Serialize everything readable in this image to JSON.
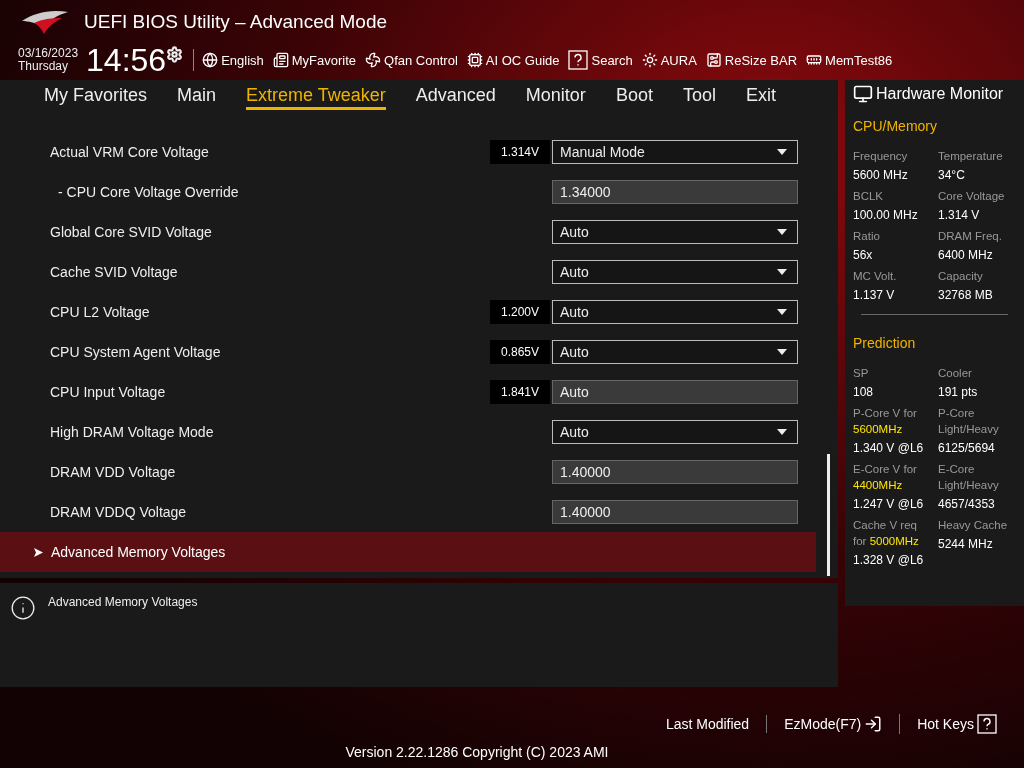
{
  "window": {
    "title": "UEFI BIOS Utility – Advanced Mode"
  },
  "clock": {
    "date": "03/16/2023",
    "day": "Thursday",
    "time": "14:56"
  },
  "toolbar": [
    {
      "label": "English",
      "kind": "globe"
    },
    {
      "label": "MyFavorite",
      "kind": "list"
    },
    {
      "label": "Qfan Control",
      "kind": "fan"
    },
    {
      "label": "AI OC Guide",
      "kind": "chip"
    },
    {
      "label": "Search",
      "kind": "help"
    },
    {
      "label": "AURA",
      "kind": "light"
    },
    {
      "label": "ReSize BAR",
      "kind": "card"
    },
    {
      "label": "MemTest86",
      "kind": "memory"
    }
  ],
  "tabs": [
    {
      "label": "My Favorites",
      "selected": false
    },
    {
      "label": "Main",
      "selected": false
    },
    {
      "label": "Extreme Tweaker",
      "selected": true
    },
    {
      "label": "Advanced",
      "selected": false
    },
    {
      "label": "Monitor",
      "selected": false
    },
    {
      "label": "Boot",
      "selected": false
    },
    {
      "label": "Tool",
      "selected": false
    },
    {
      "label": "Exit",
      "selected": false
    }
  ],
  "settings": [
    {
      "label": "Actual VRM Core Voltage",
      "reading": "1.314V",
      "kind": "dropdown",
      "value": "Manual Mode"
    },
    {
      "label": "- CPU Core Voltage Override",
      "kind": "input",
      "value": "1.34000",
      "indented": true
    },
    {
      "label": "Global Core SVID Voltage",
      "kind": "dropdown",
      "value": "Auto"
    },
    {
      "label": "Cache SVID Voltage",
      "kind": "dropdown",
      "value": "Auto"
    },
    {
      "label": "CPU L2 Voltage",
      "reading": "1.200V",
      "kind": "dropdown",
      "value": "Auto"
    },
    {
      "label": "CPU System Agent Voltage",
      "reading": "0.865V",
      "kind": "dropdown",
      "value": "Auto"
    },
    {
      "label": "CPU Input Voltage",
      "reading": "1.841V",
      "kind": "input",
      "value": "Auto"
    },
    {
      "label": "High DRAM Voltage Mode",
      "kind": "dropdown",
      "value": "Auto"
    },
    {
      "label": "DRAM VDD Voltage",
      "kind": "input",
      "value": "1.40000"
    },
    {
      "label": "DRAM VDDQ Voltage",
      "kind": "input",
      "value": "1.40000"
    },
    {
      "label": "Advanced Memory Voltages",
      "kind": "submenu",
      "selected": true
    }
  ],
  "help": {
    "text": "Advanced Memory Voltages"
  },
  "hardware_monitor": {
    "title": "Hardware Monitor",
    "sections": [
      {
        "title": "CPU/Memory",
        "items": [
          {
            "label": "Frequency",
            "value": "5600 MHz"
          },
          {
            "label": "Temperature",
            "value": "34°C"
          },
          {
            "label": "BCLK",
            "value": "100.00 MHz"
          },
          {
            "label": "Core Voltage",
            "value": "1.314 V"
          },
          {
            "label": "Ratio",
            "value": "56x"
          },
          {
            "label": "DRAM Freq.",
            "value": "6400 MHz"
          },
          {
            "label": "MC Volt.",
            "value": "1.137 V"
          },
          {
            "label": "Capacity",
            "value": "32768 MB"
          }
        ]
      },
      {
        "title": "Prediction",
        "items": [
          {
            "label": "SP",
            "value": "108"
          },
          {
            "label": "Cooler",
            "value": "191 pts"
          },
          {
            "label": "P-Core V for **5600MHz**",
            "value": "1.340 V @L6"
          },
          {
            "label": "P-Core Light/Heavy",
            "value": "6125/5694"
          },
          {
            "label": "E-Core V for **4400MHz**",
            "value": "1.247 V @L6"
          },
          {
            "label": "E-Core Light/Heavy",
            "value": "4657/4353"
          },
          {
            "label": "Cache V req for **5000MHz**",
            "value": "1.328 V @L6"
          },
          {
            "label": "Heavy Cache",
            "value": "5244 MHz"
          }
        ]
      }
    ]
  },
  "footer": {
    "actions": [
      {
        "label": "Last Modified",
        "kind": "text"
      },
      {
        "label": "EzMode(F7)",
        "kind": "exit"
      },
      {
        "label": "Hot Keys",
        "kind": "help"
      }
    ],
    "version": "Version 2.22.1286 Copyright (C) 2023 AMI"
  }
}
